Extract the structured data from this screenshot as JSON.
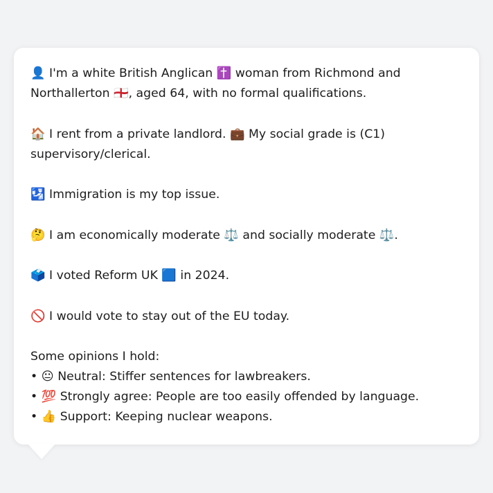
{
  "message": {
    "identity": "👤 I'm a white British Anglican ✝️ woman from Richmond and Northallerton 🏴󠁧󠁢󠁥󠁮󠁧󠁿, aged 64, with no formal qualifications.",
    "housing": "🏠 I rent from a private landlord. 💼 My social grade is (C1) supervisory/clerical.",
    "top_issue": "🛂 Immigration is my top issue.",
    "ideology": "🤔 I am economically moderate ⚖️ and socially moderate ⚖️.",
    "vote_2024": "🗳️ I voted Reform UK 🟦 in 2024.",
    "eu": "🚫 I would vote to stay out of the EU today.",
    "opinions_heading": "Some opinions I hold:",
    "opinions": [
      "• 😐 Neutral: Stiffer sentences for lawbreakers.",
      "• 💯 Strongly agree: People are too easily offended by language.",
      "• 👍 Support: Keeping nuclear weapons."
    ]
  }
}
